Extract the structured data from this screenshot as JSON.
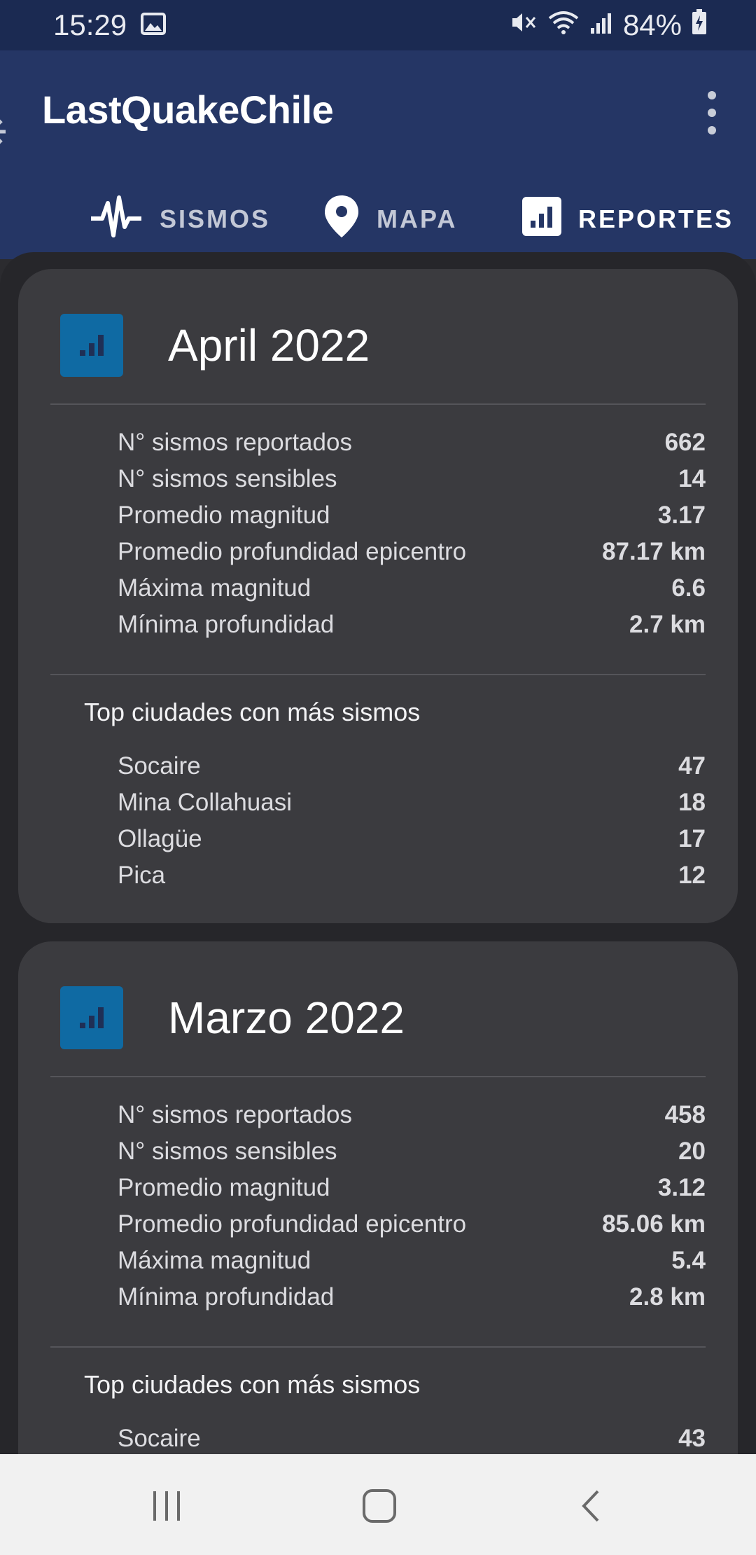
{
  "status_bar": {
    "time": "15:29",
    "battery": "84%"
  },
  "app": {
    "title": "LastQuakeChile"
  },
  "tabs": [
    {
      "label": "SISMOS",
      "icon": "seismograph-icon"
    },
    {
      "label": "MAPA",
      "icon": "map-pin-icon"
    },
    {
      "label": "REPORTES",
      "icon": "bar-chart-icon",
      "selected": true
    }
  ],
  "reports": [
    {
      "title": "April 2022",
      "stats": [
        {
          "label": "N° sismos reportados",
          "value": "662"
        },
        {
          "label": "N° sismos sensibles",
          "value": "14"
        },
        {
          "label": "Promedio magnitud",
          "value": "3.17"
        },
        {
          "label": "Promedio profundidad epicentro",
          "value": "87.17 km"
        },
        {
          "label": "Máxima magnitud",
          "value": "6.6"
        },
        {
          "label": "Mínima profundidad",
          "value": "2.7 km"
        }
      ],
      "top_title": "Top ciudades con más sismos",
      "cities": [
        {
          "label": "Socaire",
          "value": "47"
        },
        {
          "label": "Mina Collahuasi",
          "value": "18"
        },
        {
          "label": "Ollagüe",
          "value": "17"
        },
        {
          "label": "Pica",
          "value": "12"
        }
      ]
    },
    {
      "title": "Marzo 2022",
      "stats": [
        {
          "label": "N° sismos reportados",
          "value": "458"
        },
        {
          "label": "N° sismos sensibles",
          "value": "20"
        },
        {
          "label": "Promedio magnitud",
          "value": "3.12"
        },
        {
          "label": "Promedio profundidad epicentro",
          "value": "85.06 km"
        },
        {
          "label": "Máxima magnitud",
          "value": "5.4"
        },
        {
          "label": "Mínima profundidad",
          "value": "2.8 km"
        }
      ],
      "top_title": "Top ciudades con más sismos",
      "cities": [
        {
          "label": "Socaire",
          "value": "43"
        }
      ]
    }
  ],
  "colors": {
    "app_bar": "#253665",
    "status_bar": "#1b2a52",
    "card": "#3b3b3f",
    "report_icon": "#0f6aa3"
  }
}
